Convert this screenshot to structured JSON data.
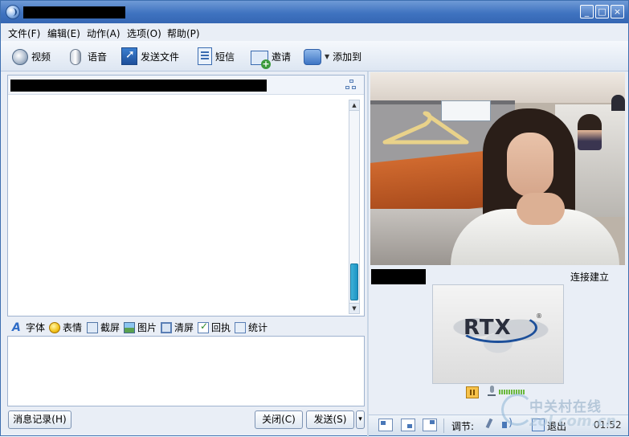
{
  "menu": {
    "items": [
      "文件(F)",
      "编辑(E)",
      "动作(A)",
      "选项(O)",
      "帮助(P)"
    ]
  },
  "toolbar": {
    "video": "视频",
    "voice": "语音",
    "send_file": "发送文件",
    "sms": "短信",
    "invite": "邀请",
    "add_to": "添加到"
  },
  "format_bar": {
    "font": "字体",
    "emoticon": "表情",
    "screenshot": "截屏",
    "picture": "图片",
    "clear": "清屏",
    "receipt": "回执",
    "stats": "统计"
  },
  "buttons": {
    "history": "消息记录(H)",
    "close": "关闭(C)",
    "send": "发送(S)",
    "send_options": "▾"
  },
  "video_panel": {
    "status": "连接建立",
    "logo": "RTX",
    "adjust_label": "调节:",
    "exit_label": "退出",
    "timer": "01:52"
  },
  "watermark": {
    "text": "中关村在线",
    "url": "zol.com.cn"
  },
  "colors": {
    "titlebar": "#3f73c0",
    "panel_bg": "#e9eef6",
    "scroll_thumb": "#1b93c4"
  }
}
